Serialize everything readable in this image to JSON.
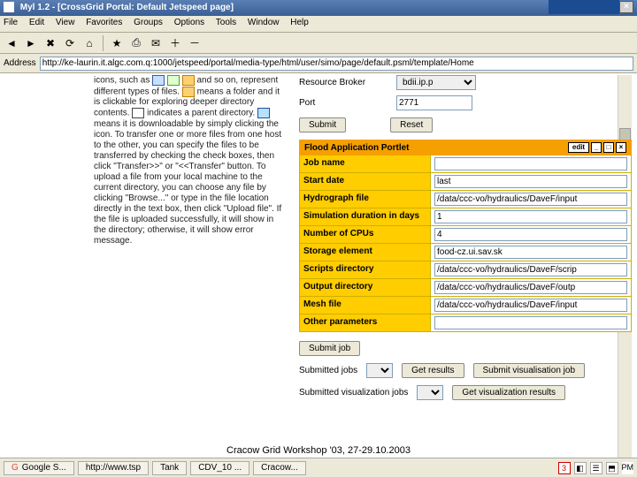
{
  "window": {
    "title": "Myl 1.2 - [CrossGrid Portal: Default Jetspeed page]"
  },
  "menu": [
    "File",
    "Edit",
    "View",
    "Favorites",
    "Groups",
    "Options",
    "Tools",
    "Window",
    "Help"
  ],
  "address": {
    "label": "Address",
    "value": "http://ke-laurin.it.algc.com.q:1000/jetspeed/portal/media-type/html/user/simo/page/default.psml/template/Home"
  },
  "left": {
    "l1": "icons, such as",
    "l2": "and so on, represent",
    "l3": "different types of files.",
    "l4": "means a folder and it",
    "l5": "is clickable for exploring deeper directory",
    "l6": "contents.",
    "l7": "indicates a parent directory.",
    "p2": "means it is downloadable by simply clicking the icon. To transfer one or more files from one host to the other, you can specify the files to be transferred by checking the check boxes, then click \"Transfer>>\" or \"<<Transfer\" button. To upload a file from your local machine to the current directory, you can choose any file by clicking \"Browse...\" or type in the file location directly in the text box, then click \"Upload file\". If the file is uploaded successfully, it will show in the directory; otherwise, it will show error message."
  },
  "broker": {
    "label": "Resource Broker",
    "value": "bdii.ip.p"
  },
  "port": {
    "label": "Port",
    "value": "2771"
  },
  "buttons": {
    "submit": "Submit",
    "reset": "Reset",
    "submitJob": "Submit job",
    "getResults": "Get results",
    "submitVis": "Submit visualisation job",
    "getVis": "Get visualization results"
  },
  "portlet": {
    "title": "Flood Application Portlet",
    "edit": "edit"
  },
  "fields": {
    "jobName": {
      "label": "Job name",
      "value": ""
    },
    "startDate": {
      "label": "Start date",
      "value": "last"
    },
    "hydrograph": {
      "label": "Hydrograph file",
      "value": "/data/ccc-vo/hydraulics/DaveF/input"
    },
    "duration": {
      "label": "Simulation duration in days",
      "value": "1"
    },
    "cpus": {
      "label": "Number of CPUs",
      "value": "4"
    },
    "storage": {
      "label": "Storage element",
      "value": "food-cz.ui.sav.sk"
    },
    "scripts": {
      "label": "Scripts directory",
      "value": "/data/ccc-vo/hydraulics/DaveF/scrip"
    },
    "output": {
      "label": "Output directory",
      "value": "/data/ccc-vo/hydraulics/DaveF/outp"
    },
    "mesh": {
      "label": "Mesh file",
      "value": "/data/ccc-vo/hydraulics/DaveF/input"
    },
    "other": {
      "label": "Other parameters",
      "value": ""
    }
  },
  "jobs": {
    "submittedLabel": "Submitted jobs",
    "visLabel": "Submitted visualization jobs"
  },
  "taskbar": {
    "b1": "Google S...",
    "b2": "http://www.tsp",
    "b3": "Tank",
    "b4": "CDV_10 ...",
    "b5": "Cracow...",
    "trayNum": "3",
    "ampm": "PM"
  },
  "footer": "Cracow Grid Workshop '03, 27-29.10.2003"
}
